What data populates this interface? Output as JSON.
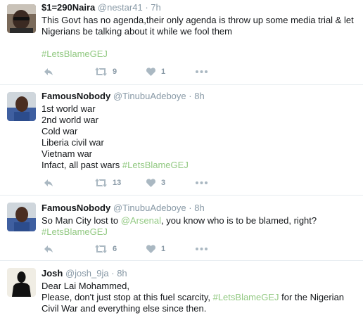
{
  "tweets": [
    {
      "name": "$1=290Naira",
      "handle": "@nestar41",
      "time": "7h",
      "text_lines": [
        "This Govt has no agenda,their only agenda is throw up some media trial & let",
        "Nigerians be talking about it while we fool them"
      ],
      "hashtag": "#LetsBlameGEJ",
      "retweets": "9",
      "likes": "1"
    },
    {
      "name": "FamousNobody",
      "handle": "@TinubuAdeboye",
      "time": "8h",
      "text_lines": [
        "1st world war",
        "2nd world war",
        "Cold war",
        "Liberia civil war",
        "Vietnam war"
      ],
      "last_line_prefix": "Infact, all past wars ",
      "hashtag": "#LetsBlameGEJ",
      "retweets": "13",
      "likes": "3"
    },
    {
      "name": "FamousNobody",
      "handle": "@TinubuAdeboye",
      "time": "8h",
      "text_prefix": "So Man City lost to ",
      "mention": "@Arsenal",
      "text_suffix": ", you know who is to be blamed, right?",
      "hashtag": "#LetsBlameGEJ",
      "retweets": "6",
      "likes": "1"
    },
    {
      "name": "Josh",
      "handle": "@josh_9ja",
      "time": "8h",
      "line1": "Dear Lai Mohammed,",
      "line2_prefix": "Please, don't just stop at this fuel scarcity, ",
      "hashtag": "#LetsBlameGEJ",
      "line2_suffix": " for the Nigerian",
      "line3": "Civil War and everything else since then."
    }
  ],
  "separator": "·",
  "icons": {
    "reply": "reply-icon",
    "retweet": "retweet-icon",
    "like": "heart-icon",
    "more": "more-icon"
  },
  "colors": {
    "hashtag": "#92c982",
    "meta": "#8899a6",
    "icon": "#aab8c2"
  }
}
